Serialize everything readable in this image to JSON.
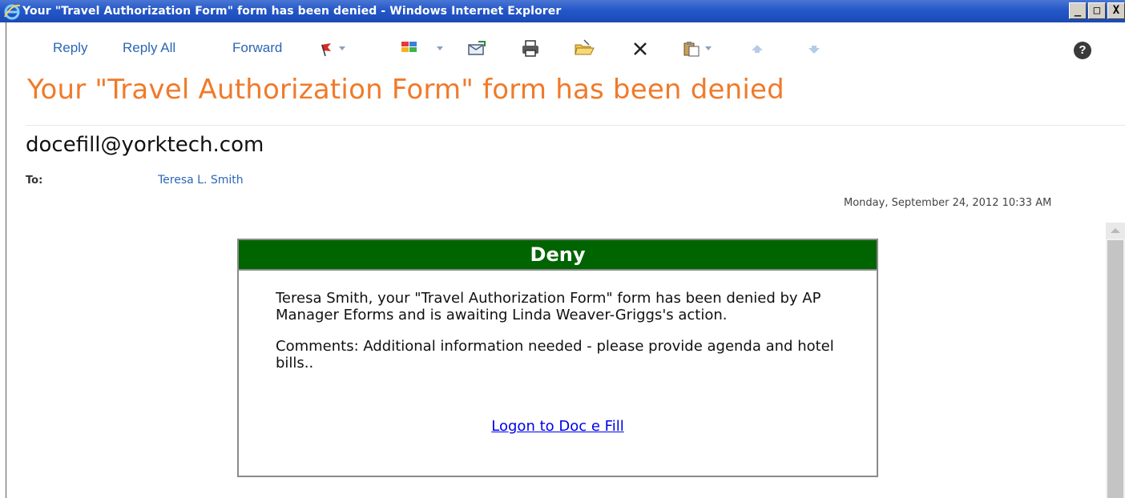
{
  "window": {
    "title": "Your \"Travel Authorization Form\" form has been denied - Windows Internet Explorer",
    "controls": [
      "_",
      "□",
      "X"
    ]
  },
  "toolbar": {
    "reply_label": "Reply",
    "reply_all_label": "Reply All",
    "forward_label": "Forward",
    "icons": [
      "flag-icon",
      "categories-icon",
      "move-to-folder-icon",
      "print-icon",
      "open-folder-icon",
      "delete-icon",
      "paste-icon",
      "previous-arrow-icon",
      "next-arrow-icon",
      "help-icon"
    ],
    "help_label": "?"
  },
  "message": {
    "subject": "Your \"Travel Authorization Form\" form has been denied",
    "sender": "docefill@yorktech.com",
    "to_label": "To:",
    "to_value": "Teresa L. Smith",
    "date": "Monday, September 24, 2012 10:33 AM"
  },
  "deny": {
    "header": "Deny",
    "body_line1": "Teresa Smith, your \"Travel Authorization Form\" form has been denied by AP Manager Eforms and is awaiting Linda Weaver-Griggs's action.",
    "comments": "Comments: Additional information needed - please provide agenda and hotel bills..",
    "link_text": "Logon to Doc e Fill",
    "header_color": "#006400"
  },
  "colors": {
    "subject": "#f07a2a",
    "link_blue": "#2b66b5",
    "titlebar": "#2457c8"
  }
}
